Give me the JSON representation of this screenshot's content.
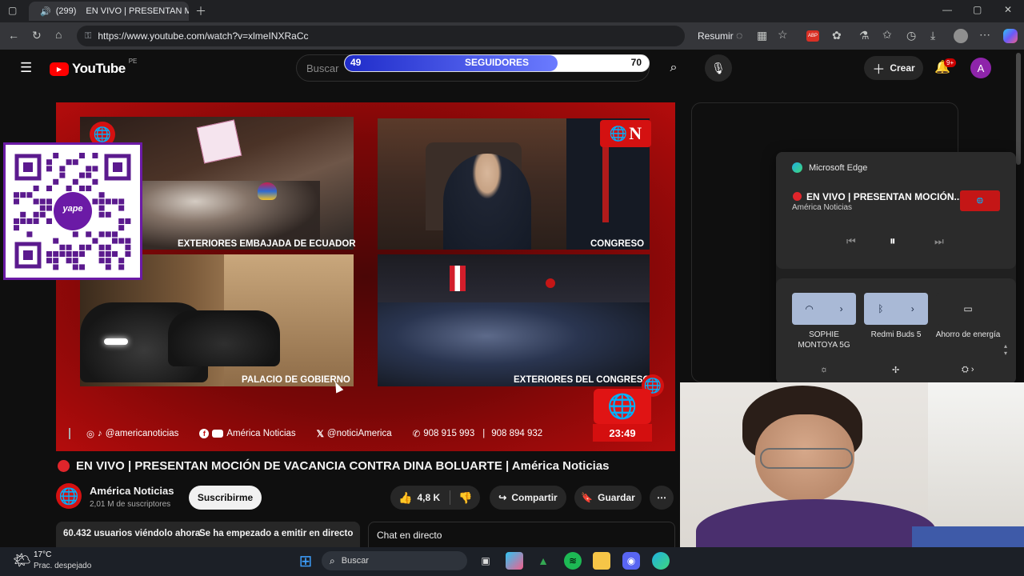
{
  "browser": {
    "tab_count": "(299)",
    "tab_title": "EN VIVO | PRESENTAN M",
    "url": "https://www.youtube.com/watch?v=xlmeINXRaCc",
    "summarize_label": "Resumir",
    "badge": "ABP"
  },
  "youtube": {
    "logo_text": "YouTube",
    "region": "PE",
    "search_placeholder": "Buscar",
    "create_label": "Crear",
    "notif_badge": "9+",
    "avatar_letter": "A"
  },
  "followers_overlay": {
    "current": "49",
    "label": "SEGUIDORES",
    "goal": "70",
    "progress": 0.7
  },
  "video": {
    "cams": [
      {
        "label": "EXTERIORES EMBAJADA DE ECUADOR"
      },
      {
        "label": "CONGRESO"
      },
      {
        "label": "PALACIO DE GOBIERNO"
      },
      {
        "label": "EXTERIORES DEL CONGRESO"
      }
    ],
    "ticker": {
      "instagram": "@americanoticias",
      "facebook": "América Noticias",
      "x": "@noticiAmerica",
      "phone1": "908 915 993",
      "separator": "|",
      "phone2": "908 894 932"
    },
    "clock": "23:49",
    "yape_text": "yape"
  },
  "title": "EN VIVO | PRESENTAN MOCIÓN DE VACANCIA CONTRA DINA BOLUARTE | América Noticias",
  "channel": {
    "name": "América Noticias",
    "subscribers": "2,01 M de suscriptores",
    "subscribe_label": "Suscribirme"
  },
  "actions": {
    "likes": "4,8 K",
    "share": "Compartir",
    "save": "Guardar",
    "more": "⋯"
  },
  "meta": {
    "viewers": "60.432 usuarios viéndolo ahora",
    "started": "Se ha empezado a emitir en directo h"
  },
  "chat_label": "Chat en directo",
  "flyout": {
    "app": "Microsoft Edge",
    "media_title": "EN VIVO | PRESENTAN MOCIÓN...",
    "media_source": "América Noticias",
    "wifi_label": "SOPHIE MONTOYA 5G",
    "bt_label": "Redmi Buds 5",
    "energy_label": "Ahorro de energía"
  },
  "taskbar": {
    "temp": "17°C",
    "weather": "Prac. despejado",
    "search": "Buscar"
  },
  "colors": {
    "accent_red": "#c20e0e",
    "youtube_red": "#ff0000",
    "follow_blue": "#2a36d4",
    "yape_purple": "#6b1aa6"
  }
}
